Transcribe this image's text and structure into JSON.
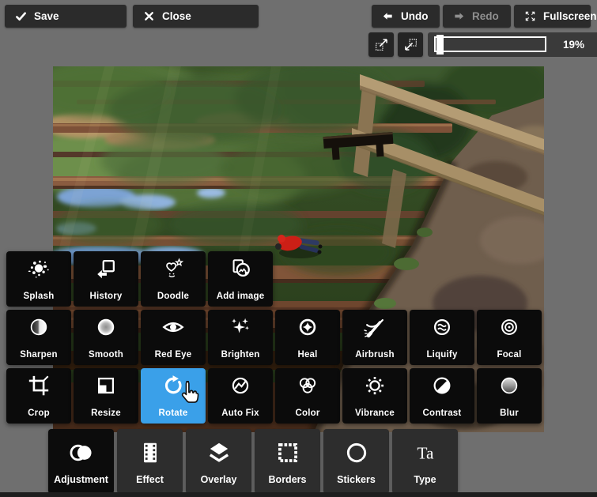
{
  "header": {
    "save_label": "Save",
    "close_label": "Close",
    "undo_label": "Undo",
    "redo_label": "Redo",
    "redo_disabled": true,
    "fullscreen_label": "Fullscreen"
  },
  "zoom_bar": {
    "level": "19%"
  },
  "canvas": {
    "alt": "Rotated photo of a redwood forest trail with a wooden fence and a hiker in red"
  },
  "tool_grid": {
    "rows": [
      {
        "tools": [
          {
            "label": "Splash",
            "icon": "splash-icon"
          },
          {
            "label": "History",
            "icon": "history-icon"
          },
          {
            "label": "Doodle",
            "icon": "doodle-icon"
          },
          {
            "label": "Add image",
            "icon": "add-image-icon"
          }
        ]
      },
      {
        "tools": [
          {
            "label": "Sharpen",
            "icon": "sharpen-icon"
          },
          {
            "label": "Smooth",
            "icon": "smooth-icon"
          },
          {
            "label": "Red Eye",
            "icon": "red-eye-icon"
          },
          {
            "label": "Brighten",
            "icon": "brighten-icon"
          },
          {
            "label": "Heal",
            "icon": "heal-icon"
          },
          {
            "label": "Airbrush",
            "icon": "airbrush-icon"
          },
          {
            "label": "Liquify",
            "icon": "liquify-icon"
          },
          {
            "label": "Focal",
            "icon": "focal-icon"
          }
        ]
      },
      {
        "tools": [
          {
            "label": "Crop",
            "icon": "crop-icon"
          },
          {
            "label": "Resize",
            "icon": "resize-icon"
          },
          {
            "label": "Rotate",
            "icon": "rotate-icon",
            "active": true
          },
          {
            "label": "Auto Fix",
            "icon": "auto-fix-icon"
          },
          {
            "label": "Color",
            "icon": "color-icon"
          },
          {
            "label": "Vibrance",
            "icon": "vibrance-icon"
          },
          {
            "label": "Contrast",
            "icon": "contrast-icon"
          },
          {
            "label": "Blur",
            "icon": "blur-icon"
          }
        ]
      }
    ]
  },
  "bottom_toolbar": {
    "items": [
      {
        "label": "Adjustment",
        "icon": "adjustment-icon",
        "active": true
      },
      {
        "label": "Effect",
        "icon": "effect-icon"
      },
      {
        "label": "Overlay",
        "icon": "overlay-icon"
      },
      {
        "label": "Borders",
        "icon": "borders-icon"
      },
      {
        "label": "Stickers",
        "icon": "stickers-icon"
      },
      {
        "label": "Type",
        "icon": "type-icon"
      }
    ]
  },
  "colors": {
    "accent_blue": "#3aa0e9",
    "page_background": "#6f6f6f",
    "tile_black": "#0b0b0b",
    "header_button": "#2b2b2b",
    "toolbar_button": "#2d2d2d"
  }
}
